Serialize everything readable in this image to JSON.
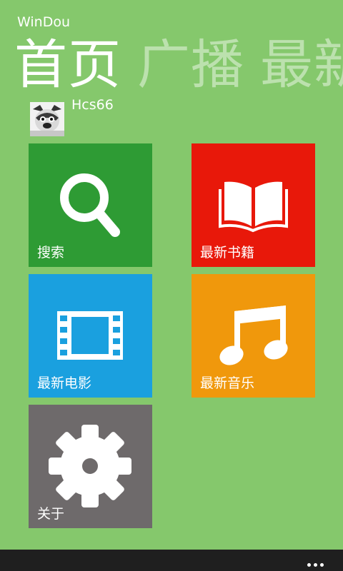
{
  "app": {
    "title": "WinDou"
  },
  "pivot": {
    "items": [
      {
        "label": "首页"
      },
      {
        "label": "广播"
      },
      {
        "label": "最新"
      }
    ]
  },
  "profile": {
    "username": "Hcs66"
  },
  "tiles": [
    {
      "label": "搜索",
      "color": "#2e9b34",
      "icon": "search-icon"
    },
    {
      "label": "最新书籍",
      "color": "#e8180a",
      "icon": "book-icon"
    },
    {
      "label": "最新电影",
      "color": "#1aa0df",
      "icon": "film-icon"
    },
    {
      "label": "最新音乐",
      "color": "#f0980c",
      "icon": "music-note-icon"
    },
    {
      "label": "关于",
      "color": "#6e6a6b",
      "icon": "gear-icon"
    }
  ],
  "colors": {
    "background": "#85c86c",
    "appbar": "#1f1f1f"
  }
}
